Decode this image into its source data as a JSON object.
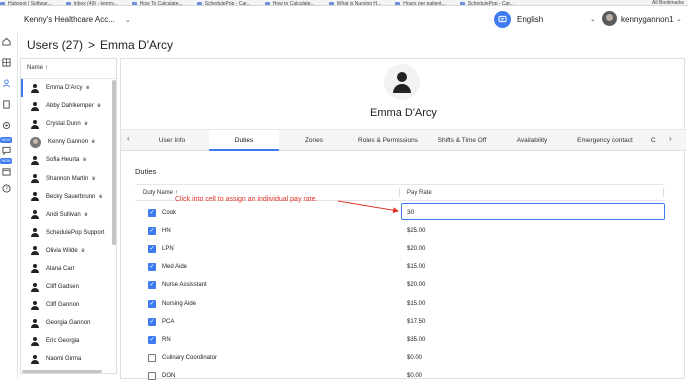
{
  "bookmarks": {
    "items": [
      "Hubspot | Softwar...",
      "Inbox (49) - kenny...",
      "How To Calculate...",
      "SchedulePop - Car...",
      "How to Calculate...",
      "What is Nursing H...",
      "Hours per patient...",
      "SchedulePop - Car..."
    ],
    "all_bookmarks": "All Bookmarks"
  },
  "header": {
    "account": "Kenny's Healthcare Acc...",
    "language": "English",
    "username": "kennygannon1"
  },
  "rail": {
    "new_badge": "NEW"
  },
  "page": {
    "title_prefix": "Users (27)",
    "separator": ">",
    "title_name": "Emma D'Arcy"
  },
  "user_list": {
    "header": "Name",
    "users": [
      {
        "name": "Emma D'Arcy",
        "crown": true,
        "photo": false
      },
      {
        "name": "Abby Dahlkemper",
        "crown": true,
        "photo": false
      },
      {
        "name": "Crystal Dunn",
        "crown": true,
        "photo": false
      },
      {
        "name": "Kenny Gannon",
        "crown": true,
        "photo": true
      },
      {
        "name": "Sofia Heurta",
        "crown": true,
        "photo": false
      },
      {
        "name": "Shannon Martin",
        "crown": true,
        "photo": false
      },
      {
        "name": "Becky Sauerbrunn",
        "crown": true,
        "photo": false
      },
      {
        "name": "Andi Sullivan",
        "crown": true,
        "photo": false
      },
      {
        "name": "SchedulePop Support",
        "crown": false,
        "photo": false
      },
      {
        "name": "Olivia Wilde",
        "crown": true,
        "photo": false
      },
      {
        "name": "Alana Carr",
        "crown": false,
        "photo": false
      },
      {
        "name": "Cliff Gadsen",
        "crown": false,
        "photo": false
      },
      {
        "name": "Cliff Gannon",
        "crown": false,
        "photo": false
      },
      {
        "name": "Georgia Gannon",
        "crown": false,
        "photo": false
      },
      {
        "name": "Eric Georgia",
        "crown": false,
        "photo": false
      },
      {
        "name": "Naomi Girma",
        "crown": false,
        "photo": false
      }
    ]
  },
  "profile": {
    "name": "Emma D'Arcy"
  },
  "tabs": [
    "User Info",
    "Duties",
    "Zones",
    "Roles & Permissions",
    "Shifts & Time Off",
    "Availability",
    "Emergency contact",
    "C"
  ],
  "active_tab": 1,
  "duties": {
    "section_title": "Duties",
    "col_duty": "Duty Name",
    "col_rate": "Pay Rate",
    "rows": [
      {
        "name": "Cook",
        "rate": "30",
        "checked": true,
        "editing": true
      },
      {
        "name": "HN",
        "rate": "$25.00",
        "checked": true
      },
      {
        "name": "LPN",
        "rate": "$20.00",
        "checked": true
      },
      {
        "name": "Med Aide",
        "rate": "$15.00",
        "checked": true
      },
      {
        "name": "Nurse Assisstant",
        "rate": "$20.00",
        "checked": true
      },
      {
        "name": "Nursing Aide",
        "rate": "$15.00",
        "checked": true
      },
      {
        "name": "PCA",
        "rate": "$17.50",
        "checked": true
      },
      {
        "name": "RN",
        "rate": "$35.00",
        "checked": true
      },
      {
        "name": "Culinary Coordinator",
        "rate": "$0.00",
        "checked": false
      },
      {
        "name": "DON",
        "rate": "$0.00",
        "checked": false
      }
    ]
  },
  "annotation": {
    "text": "Click into cell to assign an indiividual pay rate."
  },
  "colors": {
    "accent": "#3e7bf0",
    "annotation": "#e0342a"
  }
}
